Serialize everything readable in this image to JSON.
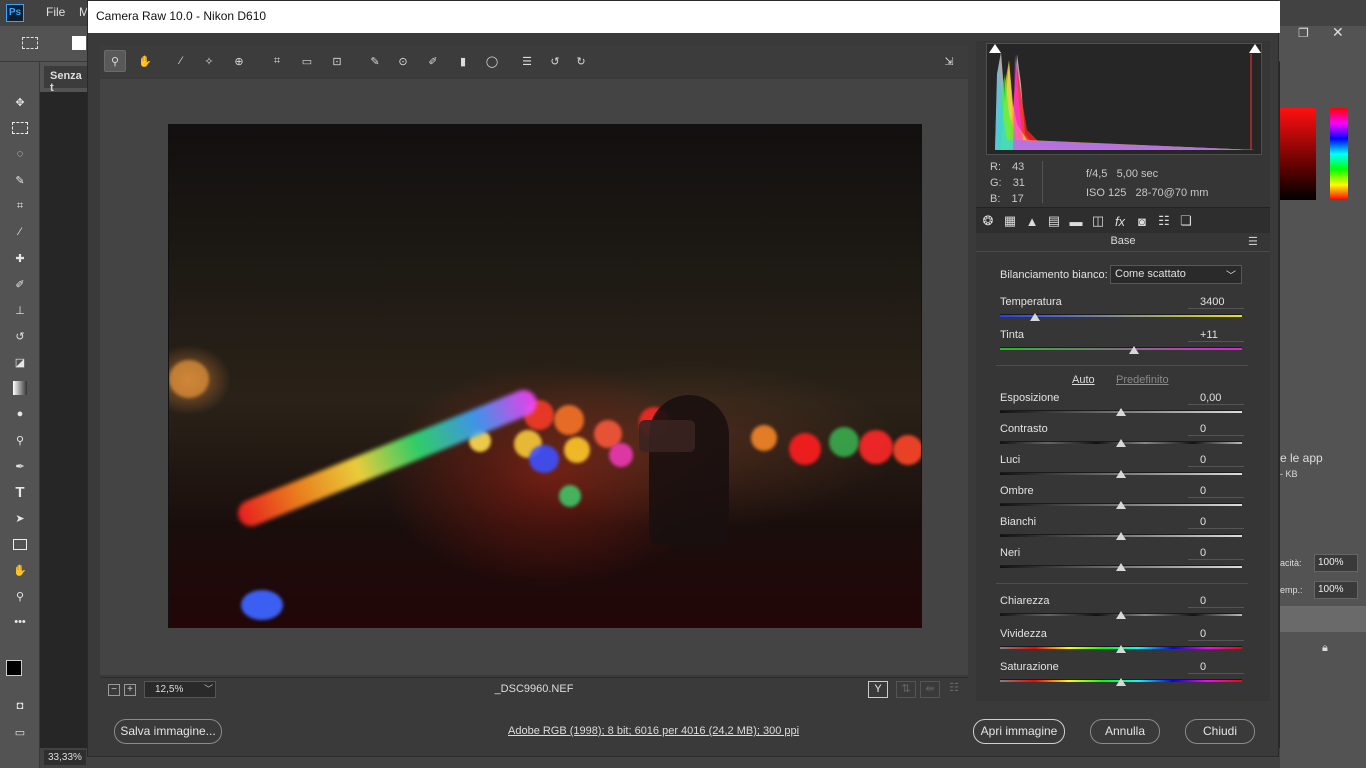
{
  "photoshop": {
    "logo": "Ps",
    "menu": [
      "File",
      "M"
    ],
    "doc_tab": "Senza t",
    "zoom": "33,33%",
    "right_panel_text": "e le app",
    "right_panel_kb": "- KB",
    "opacity_label": "acità:",
    "opacity_value": "100%",
    "fill_label": "emp.:",
    "fill_value": "100%"
  },
  "dialog": {
    "title": "Camera Raw 10.0  -  Nikon D610",
    "filename": "_DSC9960.NEF",
    "zoom_level": "12,5%",
    "rgb": {
      "r_label": "R:",
      "r": "43",
      "g_label": "G:",
      "g": "31",
      "b_label": "B:",
      "b": "17"
    },
    "exif": {
      "aperture": "f/4,5",
      "shutter": "5,00 sec",
      "iso": "ISO 125",
      "lens": "28-70@70 mm"
    },
    "panel_title": "Base",
    "wb_label": "Bilanciamento bianco:",
    "wb_value": "Come scattato",
    "auto_label": "Auto",
    "default_label": "Predefinito",
    "sliders": [
      {
        "label": "Temperatura",
        "value": "3400"
      },
      {
        "label": "Tinta",
        "value": "+11"
      },
      {
        "label": "Esposizione",
        "value": "0,00"
      },
      {
        "label": "Contrasto",
        "value": "0"
      },
      {
        "label": "Luci",
        "value": "0"
      },
      {
        "label": "Ombre",
        "value": "0"
      },
      {
        "label": "Bianchi",
        "value": "0"
      },
      {
        "label": "Neri",
        "value": "0"
      },
      {
        "label": "Chiarezza",
        "value": "0"
      },
      {
        "label": "Vividezza",
        "value": "0"
      },
      {
        "label": "Saturazione",
        "value": "0"
      }
    ],
    "footer": {
      "save": "Salva immagine...",
      "info": "Adobe RGB (1998); 8 bit; 6016 per 4016 (24,2 MB); 300 ppi",
      "open": "Apri immagine",
      "cancel": "Annulla",
      "close": "Chiudi"
    }
  },
  "colors": {
    "accent": "#31a8ff",
    "panel": "#363636",
    "dialog": "#3a3a3a"
  }
}
